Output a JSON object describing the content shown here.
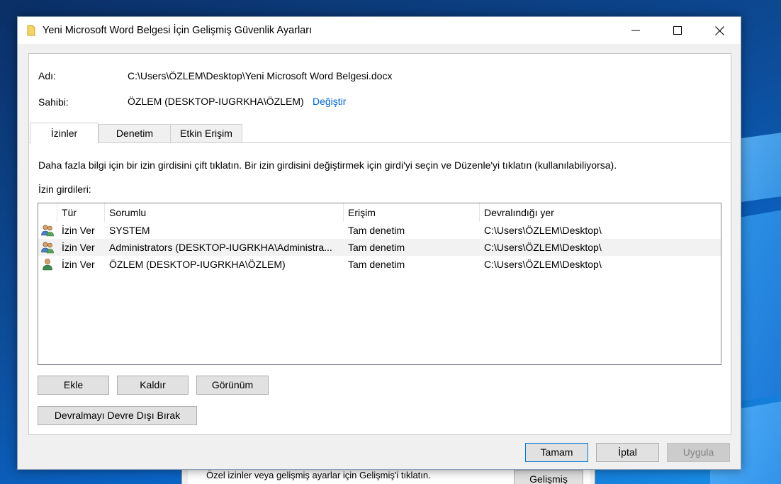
{
  "window": {
    "title": "Yeni Microsoft Word Belgesi İçin Gelişmiş Güvenlik Ayarları"
  },
  "info": {
    "name_label": "Adı:",
    "name_value": "C:\\Users\\ÖZLEM\\Desktop\\Yeni Microsoft Word Belgesi.docx",
    "owner_label": "Sahibi:",
    "owner_value": "ÖZLEM (DESKTOP-IUGRKHA\\ÖZLEM)",
    "change_link": "Değiştir"
  },
  "tabs": [
    {
      "label": "İzinler",
      "active": true
    },
    {
      "label": "Denetim",
      "active": false
    },
    {
      "label": "Etkin Erişim",
      "active": false
    }
  ],
  "permissions": {
    "description": "Daha fazla bilgi için bir izin girdisini çift tıklatın. Bir izin girdisini değiştirmek için girdi'yi seçin ve Düzenle'yi tıklatın (kullanılabiliyorsa).",
    "entries_label": "İzin girdileri:",
    "columns": [
      "Tür",
      "Sorumlu",
      "Erişim",
      "Devralındığı yer"
    ],
    "rows": [
      {
        "icon": "group-users-icon",
        "type": "İzin Ver",
        "principal": "SYSTEM",
        "access": "Tam denetim",
        "inherited": "C:\\Users\\ÖZLEM\\Desktop\\",
        "selected": false
      },
      {
        "icon": "group-users-icon",
        "type": "İzin Ver",
        "principal": "Administrators (DESKTOP-IUGRKHA\\Administra...",
        "access": "Tam denetim",
        "inherited": "C:\\Users\\ÖZLEM\\Desktop\\",
        "selected": true
      },
      {
        "icon": "single-user-icon",
        "type": "İzin Ver",
        "principal": "ÖZLEM (DESKTOP-IUGRKHA\\ÖZLEM)",
        "access": "Tam denetim",
        "inherited": "C:\\Users\\ÖZLEM\\Desktop\\",
        "selected": false
      }
    ],
    "buttons": {
      "add": "Ekle",
      "remove": "Kaldır",
      "view": "Görünüm",
      "disable_inheritance": "Devralmayı Devre Dışı Bırak"
    }
  },
  "footer": {
    "ok": "Tamam",
    "cancel": "İptal",
    "apply": "Uygula"
  },
  "background_dialog": {
    "text": "Özel izinler veya gelişmiş ayarlar için Gelişmiş'i tıklatın.",
    "advanced_button": "Gelişmiş"
  },
  "colors": {
    "accent": "#0078d7",
    "link": "#0066cc",
    "selected_row": "#f2f2f2"
  }
}
